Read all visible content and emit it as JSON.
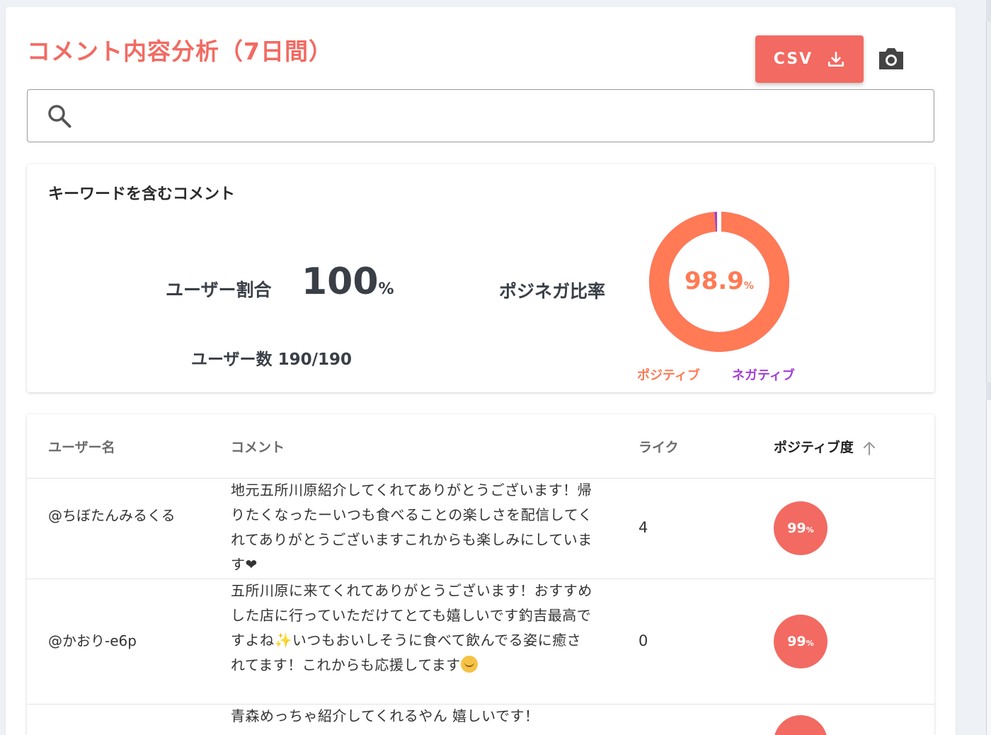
{
  "header": {
    "title": "コメント内容分析（7日間）",
    "csv_label": "CSV",
    "download_icon": "download-icon",
    "camera_icon": "camera-icon"
  },
  "search": {
    "placeholder": "",
    "value": "",
    "icon": "search-icon"
  },
  "keyword_card": {
    "title": "キーワードを含むコメント",
    "user_ratio_label": "ユーザー割合",
    "user_ratio_value": "100",
    "user_ratio_unit": "%",
    "user_count_label": "ユーザー数",
    "user_count_value": "190/190",
    "pn_label": "ポジネガ比率",
    "pn_value": "98.9",
    "pn_unit": "%",
    "pn_fraction": 0.989,
    "legend_positive": "ポジティブ",
    "legend_negative": "ネガティブ",
    "positive_color": "#ff7a55",
    "negative_color": "#a23fd6"
  },
  "table": {
    "headers": {
      "user": "ユーザー名",
      "comment": "コメント",
      "likes": "ライク",
      "positivity": "ポジティブ度"
    },
    "sort_icon": "arrow-up-icon",
    "rows": [
      {
        "user": "@ちぼたんみるくる",
        "comment": "地元五所川原紹介してくれてありがとうございます！帰りたくなったーいつも食べることの楽しさを配信してくれてありがとうございますこれからも楽しみにしています❤",
        "likes": "4",
        "positivity": "99",
        "positivity_unit": "%"
      },
      {
        "user": "@かおり-e6p",
        "comment_parts": [
          "五所川原に来てくれてありがとうございます！おすすめした店に行っていただけてとても嬉しいです釣吉最高ですよね",
          "✨",
          "いつもおいしそうに食べて飲んでる姿に癒されてます！これからも応援してます"
        ],
        "likes": "0",
        "positivity": "99",
        "positivity_unit": "%"
      },
      {
        "user": "",
        "comment": "青森めっちゃ紹介してくれるやん 嬉しいです！",
        "likes": "",
        "positivity": ""
      }
    ]
  },
  "colors": {
    "accent": "#f26a62",
    "text_dark": "#3a3f47"
  }
}
